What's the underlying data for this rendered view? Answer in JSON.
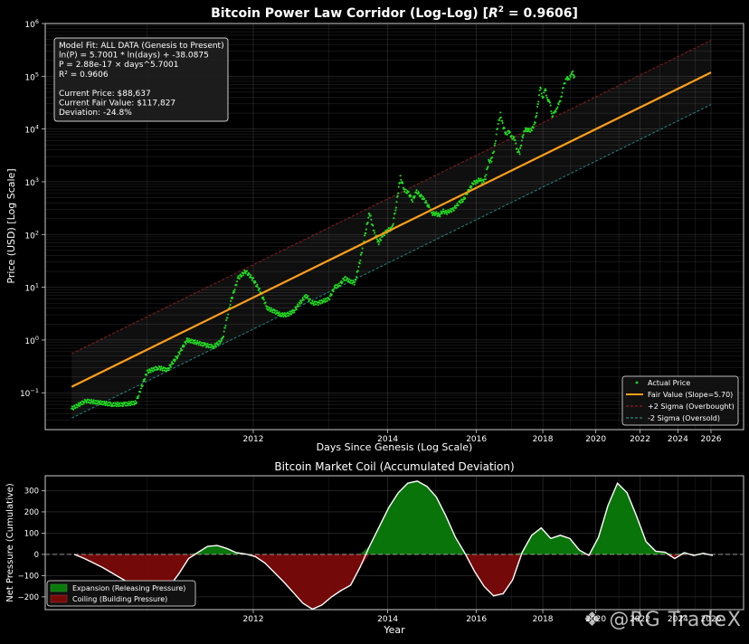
{
  "watermark": "@RG TradeX",
  "chart_data": [
    {
      "type": "scatter",
      "title": "Bitcoin Power Law Corridor (Log-Log) [R² = 0.9606]",
      "title_main": "Bitcoin Power Law Corridor (Log-Log) [",
      "title_r2": "R",
      "title_sup": "2",
      "title_tail": " = 0.9606]",
      "xlabel": "Days Since Genesis (Log Scale)",
      "ylabel": "Price (USD) [Log Scale]",
      "x_scale": "log (days since genesis, labelled by year)",
      "y_scale": "log",
      "ylim": [
        0.02,
        1000000
      ],
      "y_ticks": [
        {
          "v": 0.1,
          "b": "10",
          "e": "−1"
        },
        {
          "v": 1,
          "b": "10",
          "e": "0"
        },
        {
          "v": 10,
          "b": "10",
          "e": "1"
        },
        {
          "v": 100,
          "b": "10",
          "e": "2"
        },
        {
          "v": 1000,
          "b": "10",
          "e": "3"
        },
        {
          "v": 10000,
          "b": "10",
          "e": "4"
        },
        {
          "v": 100000,
          "b": "10",
          "e": "5"
        },
        {
          "v": 1000000,
          "b": "10",
          "e": "6"
        }
      ],
      "x_ticks": [
        "2012",
        "2014",
        "2016",
        "2018",
        "2020",
        "2022",
        "2024",
        "2026"
      ],
      "grid": true,
      "legend_position": "bottom-right",
      "legend": [
        "Actual Price",
        "Fair Value (Slope=5.70)",
        "+2 Sigma (Overbought)",
        "-2 Sigma (Oversold)"
      ],
      "info_box": [
        "Model Fit: ALL DATA (Genesis to Present)",
        "ln(P) = 5.7001 * ln(days) + -38.0875",
        "P = 2.88e-17 × days^5.7001",
        "R² = 0.9606",
        "",
        "Current Price: $88,637",
        "Current Fair Value: $117,827",
        "Deviation: -24.8%"
      ],
      "model": {
        "slope": 5.7001,
        "intercept": -38.0875,
        "r2": 0.9606,
        "fair_value_now": 117827,
        "current_price": 88637,
        "deviation_pct": -24.8
      },
      "fair_value_line": {
        "date_start": "2010-07",
        "date_end": "2026-01",
        "start": 0.13,
        "end": 117827
      },
      "upper_band": {
        "start": 0.55,
        "end": 480000
      },
      "lower_band": {
        "start": 0.033,
        "end": 29000
      },
      "colors": {
        "price": "#22dd22",
        "fair": "#ff9f1a",
        "upper": "#b02222",
        "lower": "#2aa6a0"
      },
      "price_series": [
        [
          "2010-07",
          0.05
        ],
        [
          "2010-08",
          0.07
        ],
        [
          "2010-09",
          0.065
        ],
        [
          "2010-10",
          0.06
        ],
        [
          "2010-11",
          0.06
        ],
        [
          "2010-12",
          0.065
        ],
        [
          "2011-01",
          0.25
        ],
        [
          "2011-02",
          0.3
        ],
        [
          "2011-03",
          0.27
        ],
        [
          "2011-04",
          0.5
        ],
        [
          "2011-05",
          1.0
        ],
        [
          "2011-06",
          0.9
        ],
        [
          "2011-07",
          0.8
        ],
        [
          "2011-08",
          0.75
        ],
        [
          "2011-09",
          1.0
        ],
        [
          "2011-10",
          5
        ],
        [
          "2011-11",
          15
        ],
        [
          "2011-12",
          20
        ],
        [
          "2012-01",
          14
        ],
        [
          "2012-02",
          8
        ],
        [
          "2012-03",
          4
        ],
        [
          "2012-04",
          3.5
        ],
        [
          "2012-05",
          3
        ],
        [
          "2012-06",
          3
        ],
        [
          "2012-07",
          3.5
        ],
        [
          "2012-08",
          5
        ],
        [
          "2012-09",
          7
        ],
        [
          "2012-10",
          5
        ],
        [
          "2012-11",
          5
        ],
        [
          "2012-12",
          5.5
        ],
        [
          "2013-01",
          6
        ],
        [
          "2013-02",
          10
        ],
        [
          "2013-03",
          11
        ],
        [
          "2013-04",
          15
        ],
        [
          "2013-05",
          13
        ],
        [
          "2013-06",
          12
        ],
        [
          "2013-07",
          30
        ],
        [
          "2013-08",
          90
        ],
        [
          "2013-09",
          260
        ],
        [
          "2013-10",
          110
        ],
        [
          "2013-11",
          70
        ],
        [
          "2013-12",
          100
        ],
        [
          "2014-01",
          120
        ],
        [
          "2014-02",
          130
        ],
        [
          "2014-03",
          350
        ],
        [
          "2014-04",
          1200
        ],
        [
          "2014-05",
          700
        ],
        [
          "2014-06",
          600
        ],
        [
          "2014-07",
          450
        ],
        [
          "2014-08",
          650
        ],
        [
          "2014-09",
          550
        ],
        [
          "2014-10",
          450
        ],
        [
          "2014-11",
          350
        ],
        [
          "2014-12",
          250
        ],
        [
          "2015-01",
          250
        ],
        [
          "2015-02",
          230
        ],
        [
          "2015-03",
          280
        ],
        [
          "2015-04",
          260
        ],
        [
          "2015-05",
          280
        ],
        [
          "2015-06",
          300
        ],
        [
          "2015-07",
          350
        ],
        [
          "2015-08",
          420
        ],
        [
          "2015-09",
          450
        ],
        [
          "2015-10",
          600
        ],
        [
          "2015-11",
          750
        ],
        [
          "2015-12",
          950
        ],
        [
          "2016-01",
          1000
        ],
        [
          "2016-02",
          1100
        ],
        [
          "2016-03",
          1000
        ],
        [
          "2016-04",
          1200
        ],
        [
          "2016-05",
          2400
        ],
        [
          "2016-06",
          2600
        ],
        [
          "2016-07",
          4500
        ],
        [
          "2016-08",
          11000
        ],
        [
          "2016-09",
          19000
        ],
        [
          "2016-10",
          11000
        ],
        [
          "2016-11",
          8000
        ],
        [
          "2016-12",
          9000
        ],
        [
          "2017-01",
          7000
        ],
        [
          "2017-02",
          6500
        ],
        [
          "2017-03",
          4000
        ],
        [
          "2017-04",
          3500
        ],
        [
          "2017-05",
          7000
        ],
        [
          "2017-06",
          9500
        ],
        [
          "2017-07",
          10000
        ],
        [
          "2017-08",
          9000
        ],
        [
          "2017-09",
          11000
        ],
        [
          "2017-10",
          13000
        ],
        [
          "2017-11",
          30000
        ],
        [
          "2017-12",
          60000
        ],
        [
          "2018-01",
          40000
        ],
        [
          "2018-02",
          55000
        ],
        [
          "2018-03",
          38000
        ],
        [
          "2018-04",
          30000
        ],
        [
          "2018-05",
          18000
        ],
        [
          "2018-06",
          20000
        ],
        [
          "2018-07",
          26000
        ],
        [
          "2018-08",
          30000
        ],
        [
          "2018-09",
          45000
        ],
        [
          "2018-10",
          67000
        ],
        [
          "2018-11",
          95000
        ],
        [
          "2018-12",
          85000
        ],
        [
          "2019-01",
          105000
        ],
        [
          "2019-02",
          115000
        ],
        [
          "2019-03",
          88637
        ]
      ]
    },
    {
      "type": "area",
      "title": "Bitcoin Market Coil (Accumulated Deviation)",
      "xlabel": "Year",
      "ylabel": "Net Pressure (Cumulative)",
      "ylim": [
        -260,
        370
      ],
      "y_ticks": [
        -200,
        -100,
        0,
        100,
        200,
        300
      ],
      "x_ticks": [
        "2012",
        "2014",
        "2016",
        "2018",
        "2020",
        "2022",
        "2024",
        "2026"
      ],
      "grid": true,
      "legend_position": "bottom-left",
      "legend": [
        "Expansion (Releasing Pressure)",
        "Coiling (Building Pressure)"
      ],
      "colors": {
        "expansion": "#0a7a0a",
        "coiling": "#7a0a0a"
      },
      "series": [
        [
          "2010-06",
          0
        ],
        [
          "2010-09",
          -18
        ],
        [
          "2010-12",
          -40
        ],
        [
          "2011-03",
          -62
        ],
        [
          "2011-06",
          -88
        ],
        [
          "2011-09",
          -115
        ],
        [
          "2011-12",
          -140
        ],
        [
          "2012-03",
          -150
        ],
        [
          "2012-06",
          -165
        ],
        [
          "2012-09",
          -175
        ],
        [
          "2012-12",
          -150
        ],
        [
          "2013-03",
          -90
        ],
        [
          "2013-06",
          -20
        ],
        [
          "2013-07",
          10
        ],
        [
          "2013-09",
          38
        ],
        [
          "2013-11",
          42
        ],
        [
          "2014-01",
          28
        ],
        [
          "2014-03",
          8
        ],
        [
          "2014-05",
          2
        ],
        [
          "2014-08",
          -10
        ],
        [
          "2014-11",
          -40
        ],
        [
          "2015-02",
          -85
        ],
        [
          "2015-05",
          -130
        ],
        [
          "2015-08",
          -180
        ],
        [
          "2015-10",
          -230
        ],
        [
          "2015-12",
          -258
        ],
        [
          "2016-02",
          -238
        ],
        [
          "2016-04",
          -200
        ],
        [
          "2016-07",
          -170
        ],
        [
          "2016-10",
          -145
        ],
        [
          "2016-12",
          -60
        ],
        [
          "2017-02",
          40
        ],
        [
          "2017-04",
          130
        ],
        [
          "2017-06",
          220
        ],
        [
          "2017-08",
          290
        ],
        [
          "2017-10",
          335
        ],
        [
          "2017-12",
          345
        ],
        [
          "2018-02",
          320
        ],
        [
          "2018-04",
          270
        ],
        [
          "2018-07",
          180
        ],
        [
          "2018-10",
          80
        ],
        [
          "2019-01",
          5
        ],
        [
          "2019-04",
          -80
        ],
        [
          "2019-07",
          -150
        ],
        [
          "2019-09",
          -195
        ],
        [
          "2019-11",
          -185
        ],
        [
          "2020-01",
          -120
        ],
        [
          "2020-03",
          10
        ],
        [
          "2020-05",
          90
        ],
        [
          "2020-07",
          125
        ],
        [
          "2020-09",
          75
        ],
        [
          "2020-11",
          90
        ],
        [
          "2021-01",
          75
        ],
        [
          "2021-03",
          20
        ],
        [
          "2021-05",
          -5
        ],
        [
          "2021-07",
          80
        ],
        [
          "2021-09",
          230
        ],
        [
          "2021-11",
          335
        ],
        [
          "2022-01",
          290
        ],
        [
          "2022-03",
          180
        ],
        [
          "2022-05",
          60
        ],
        [
          "2022-07",
          15
        ],
        [
          "2022-09",
          10
        ],
        [
          "2022-11",
          -20
        ],
        [
          "2023-01",
          8
        ],
        [
          "2023-03",
          -5
        ],
        [
          "2023-05",
          5
        ],
        [
          "2023-07",
          -5
        ]
      ]
    }
  ]
}
